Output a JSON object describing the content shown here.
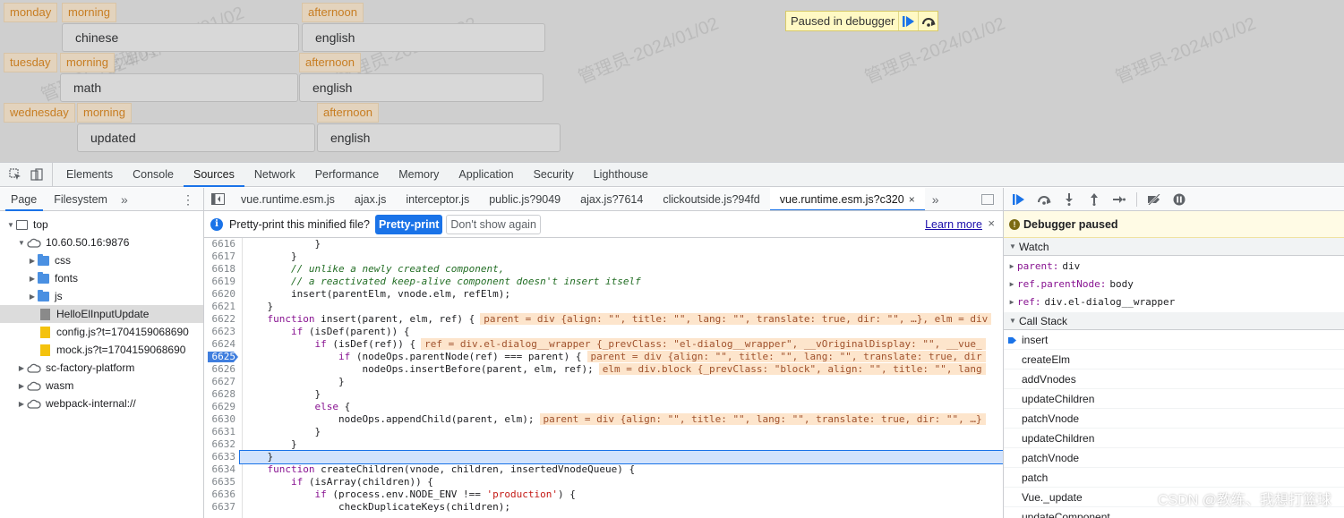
{
  "page": {
    "rows": [
      {
        "day": "monday",
        "period1": "morning",
        "subject1": "chinese",
        "period2": "afternoon",
        "subject2": "english"
      },
      {
        "day": "tuesday",
        "period1": "morning",
        "subject1": "math",
        "period2": "afternoon",
        "subject2": "english"
      },
      {
        "day": "wednesday",
        "period1": "morning",
        "subject1": "updated",
        "period2": "afternoon",
        "subject2": "english"
      }
    ],
    "watermark": "管理员-2024/01/02",
    "paused_label": "Paused in debugger"
  },
  "devtools": {
    "tabs": [
      "Elements",
      "Console",
      "Sources",
      "Network",
      "Performance",
      "Memory",
      "Application",
      "Security",
      "Lighthouse"
    ],
    "active_tab": "Sources",
    "navigator": {
      "tabs": [
        "Page",
        "Filesystem"
      ],
      "more": "»",
      "tree": [
        {
          "label": "top"
        },
        {
          "label": "10.60.50.16:9876"
        },
        {
          "label": "css"
        },
        {
          "label": "fonts"
        },
        {
          "label": "js"
        },
        {
          "label": "HelloElInputUpdate"
        },
        {
          "label": "config.js?t=1704159068690"
        },
        {
          "label": "mock.js?t=1704159068690"
        },
        {
          "label": "sc-factory-platform"
        },
        {
          "label": "wasm"
        },
        {
          "label": "webpack-internal://"
        }
      ]
    },
    "editor": {
      "file_tabs": [
        "vue.runtime.esm.js",
        "ajax.js",
        "interceptor.js",
        "public.js?9049",
        "ajax.js?7614",
        "clickoutside.js?94fd",
        "vue.runtime.esm.js?c320"
      ],
      "close_glyph": "×",
      "more": "»",
      "prettyprint": {
        "message": "Pretty-print this minified file?",
        "primary": "Pretty-print",
        "secondary": "Don't show again",
        "learn_more": "Learn more",
        "close": "×"
      },
      "lines": [
        {
          "n": "6616",
          "code": "            }"
        },
        {
          "n": "6617",
          "code": "        }"
        },
        {
          "n": "6618",
          "code": "        // unlike a newly created component,"
        },
        {
          "n": "6619",
          "code": "        // a reactivated keep-alive component doesn't insert itself"
        },
        {
          "n": "6620",
          "code": "        insert(parentElm, vnode.elm, refElm);"
        },
        {
          "n": "6621",
          "code": "    }"
        },
        {
          "n": "6622",
          "code": "    function insert(parent, elm, ref) {",
          "val": "parent = div {align: \"\", title: \"\", lang: \"\", translate: true, dir: \"\", …}, elm = div"
        },
        {
          "n": "6623",
          "code": "        if (isDef(parent)) {"
        },
        {
          "n": "6624",
          "code": "            if (isDef(ref)) {",
          "val": "ref = div.el-dialog__wrapper {_prevClass: \"el-dialog__wrapper\", __vOriginalDisplay: \"\", __vue_"
        },
        {
          "n": "6625",
          "code": "                if (nodeOps.parentNode(ref) === parent) {",
          "val": "parent = div {align: \"\", title: \"\", lang: \"\", translate: true, dir"
        },
        {
          "n": "6626",
          "code": "                    nodeOps.insertBefore(parent, elm, ref);",
          "val": "elm = div.block {_prevClass: \"block\", align: \"\", title: \"\", lang"
        },
        {
          "n": "6627",
          "code": "                }"
        },
        {
          "n": "6628",
          "code": "            }"
        },
        {
          "n": "6629",
          "code": "            else {"
        },
        {
          "n": "6630",
          "code": "                nodeOps.appendChild(parent, elm);",
          "val": "parent = div {align: \"\", title: \"\", lang: \"\", translate: true, dir: \"\", …}"
        },
        {
          "n": "6631",
          "code": "            }"
        },
        {
          "n": "6632",
          "code": "        }"
        },
        {
          "n": "6633",
          "code": "    }"
        },
        {
          "n": "6634",
          "code": "    function createChildren(vnode, children, insertedVnodeQueue) {"
        },
        {
          "n": "6635",
          "code": "        if (isArray(children)) {"
        },
        {
          "n": "6636",
          "code": "            if (process.env.NODE_ENV !== 'production') {"
        },
        {
          "n": "6637",
          "code": "                checkDuplicateKeys(children);"
        }
      ]
    },
    "debugger": {
      "paused": "Debugger paused",
      "watch_title": "Watch",
      "watch": [
        {
          "key": "parent:",
          "value": "div"
        },
        {
          "key": "ref.parentNode:",
          "value": "body"
        },
        {
          "key": "ref:",
          "value": "div.el-dialog__wrapper"
        }
      ],
      "callstack_title": "Call Stack",
      "callstack": [
        "insert",
        "createElm",
        "addVnodes",
        "updateChildren",
        "patchVnode",
        "updateChildren",
        "patchVnode",
        "patch",
        "Vue._update",
        "updateComponent"
      ]
    }
  },
  "csdn": "CSDN @教练、我想打篮球",
  "colors": {
    "accent": "#1a73e8",
    "chip_text": "#c77d22",
    "inline_value_bg": "#fde5cc"
  }
}
